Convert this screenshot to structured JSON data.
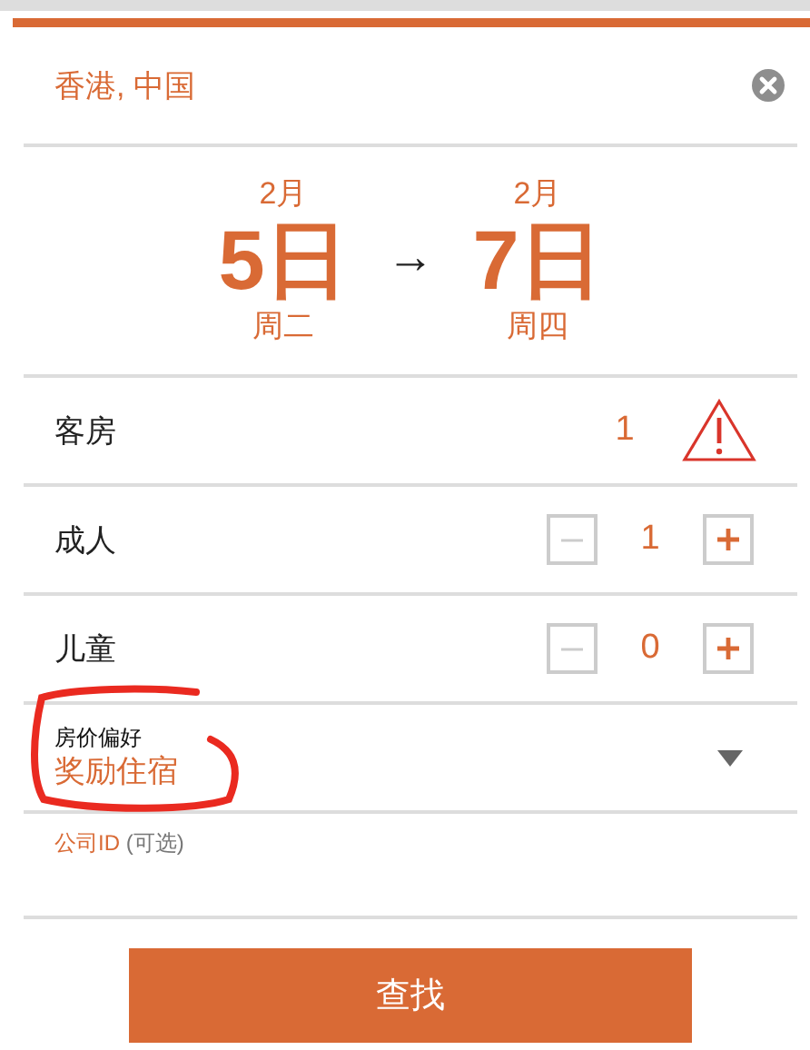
{
  "location": {
    "value": "香港, 中国"
  },
  "dates": {
    "checkin": {
      "month": "2月",
      "day": "5日",
      "weekday": "周二"
    },
    "arrow": "→",
    "checkout": {
      "month": "2月",
      "day": "7日",
      "weekday": "周四"
    }
  },
  "counters": [
    {
      "kind": "warning",
      "label": "客房",
      "value": "1"
    },
    {
      "kind": "stepper",
      "label": "成人",
      "value": "1",
      "minus_disabled": true,
      "plus_disabled": false
    },
    {
      "kind": "stepper",
      "label": "儿童",
      "value": "0",
      "minus_disabled": true,
      "plus_disabled": false
    }
  ],
  "rate_preference": {
    "label": "房价偏好",
    "value": "奖励住宿"
  },
  "company_id": {
    "label": "公司ID",
    "hint": "(可选)"
  },
  "search_button": "查找",
  "annotations": [
    {
      "kind": "circle"
    }
  ]
}
